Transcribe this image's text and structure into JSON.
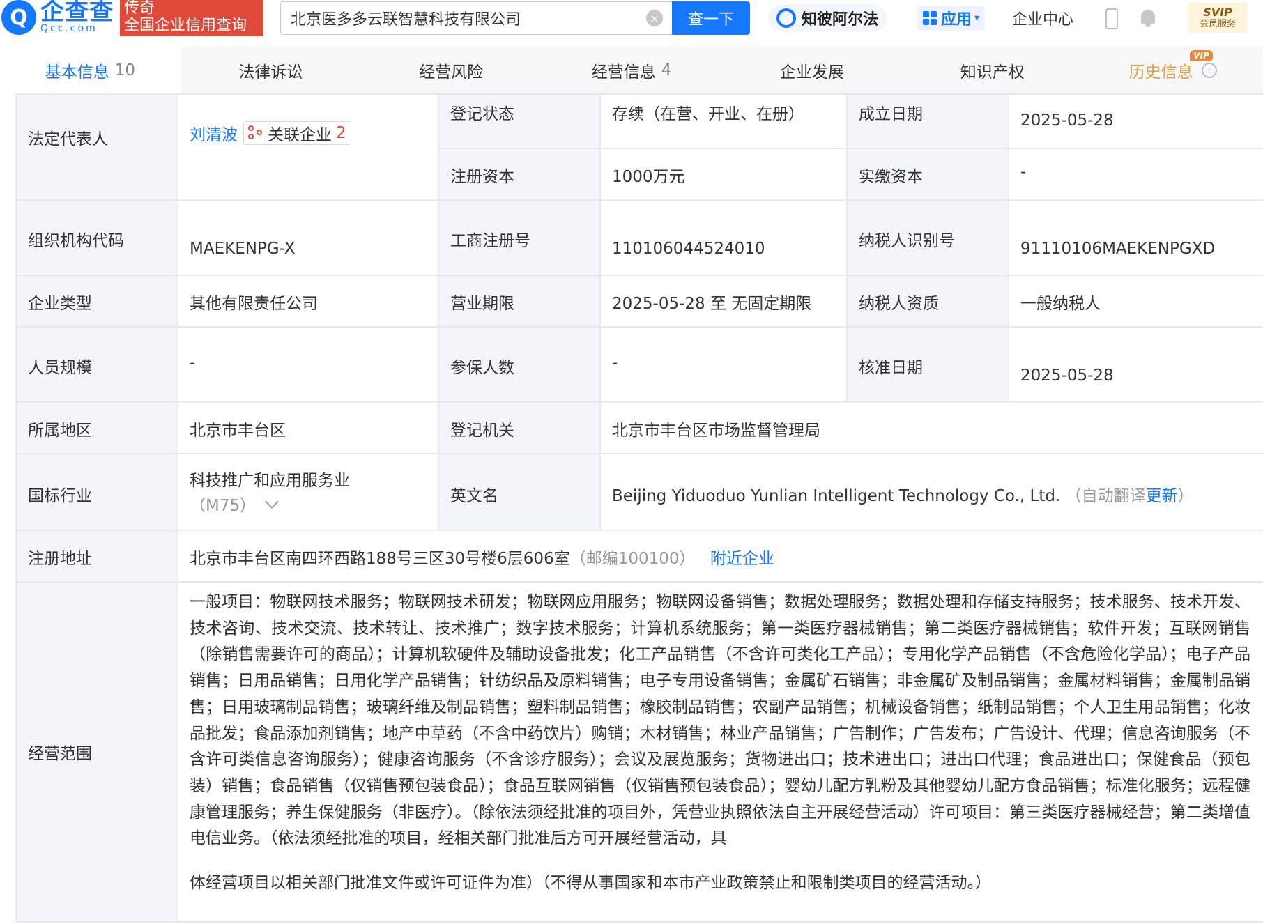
{
  "header": {
    "logo_icon": "Q",
    "logo_main": "企查查",
    "logo_sub": "Qcc.com",
    "slogan_top": "传奇",
    "slogan_bottom": "全国企业信用查询",
    "search_value": "北京医多多云联智慧科技有限公司",
    "clear_symbol": "×",
    "search_button": "查一下",
    "zhibi_label": "知彼阿尔法",
    "apps_label": "应用",
    "apps_caret": "▾",
    "center_label": "企业中心",
    "svip_line1": "SVIP",
    "svip_line2": "会员服务"
  },
  "tabs": [
    {
      "label": "基本信息",
      "count": "10"
    },
    {
      "label": "法律诉讼",
      "count": ""
    },
    {
      "label": "经营风险",
      "count": ""
    },
    {
      "label": "经营信息",
      "count": "4"
    },
    {
      "label": "企业发展",
      "count": ""
    },
    {
      "label": "知识产权",
      "count": ""
    },
    {
      "label": "历史信息",
      "count": "",
      "badge": "VIP"
    }
  ],
  "info_icon_symbol": "i",
  "table": {
    "legal_rep_label": "法定代表人",
    "legal_rep_name": "刘清波",
    "related_label": "关联企业",
    "related_count": "2",
    "reg_status_label": "登记状态",
    "reg_status": "存续（在营、开业、在册）",
    "founded_label": "成立日期",
    "founded": "2025-05-28",
    "reg_capital_label": "注册资本",
    "reg_capital": "1000万元",
    "paid_capital_label": "实缴资本",
    "paid_capital": "-",
    "org_code_label": "组织机构代码",
    "org_code": "MAEKENPG-X",
    "biz_reg_no_label": "工商注册号",
    "biz_reg_no": "110106044524010",
    "tax_id_label": "纳税人识别号",
    "tax_id": "91110106MAEKENPGXD",
    "company_type_label": "企业类型",
    "company_type": "其他有限责任公司",
    "biz_term_label": "营业期限",
    "biz_term": "2025-05-28 至 无固定期限",
    "taxpayer_label": "纳税人资质",
    "taxpayer": "一般纳税人",
    "staff_label": "人员规模",
    "staff": "-",
    "insured_label": "参保人数",
    "insured": "-",
    "approved_label": "核准日期",
    "approved": "2025-05-28",
    "region_label": "所属地区",
    "region": "北京市丰台区",
    "authority_label": "登记机关",
    "authority": "北京市丰台区市场监督管理局",
    "industry_label": "国标行业",
    "industry": "科技推广和应用服务业",
    "industry_code": "（M75）",
    "english_label": "英文名",
    "english_name": "Beijing Yiduoduo Yunlian Intelligent Technology Co., Ltd.",
    "english_note_open": "（自动翻译",
    "english_update": "更新",
    "english_note_close": "）",
    "address_label": "注册地址",
    "address": "北京市丰台区南四环西路188号三区30号楼6层606室",
    "postcode": "（邮编100100）",
    "nearby": "附近企业",
    "scope_label": "经营范围",
    "scope_main": "一般项目：物联网技术服务；物联网技术研发；物联网应用服务；物联网设备销售；数据处理服务；数据处理和存储支持服务；技术服务、技术开发、技术咨询、技术交流、技术转让、技术推广；数字技术服务；计算机系统服务；第一类医疗器械销售；第二类医疗器械销售；软件开发；互联网销售（除销售需要许可的商品）；计算机软硬件及辅助设备批发；化工产品销售（不含许可类化工产品）；专用化学产品销售（不含危险化学品）；电子产品销售；日用品销售；日用化学产品销售；针纺织品及原料销售；电子专用设备销售；金属矿石销售；非金属矿及制品销售；金属材料销售；金属制品销售；日用玻璃制品销售；玻璃纤维及制品销售；塑料制品销售；橡胶制品销售；农副产品销售；机械设备销售；纸制品销售；个人卫生用品销售；化妆品批发；食品添加剂销售；地产中草药（不含中药饮片）购销；木材销售；林业产品销售；广告制作；广告发布；广告设计、代理；信息咨询服务（不含许可类信息咨询服务）；健康咨询服务（不含诊疗服务）；会议及展览服务；货物进出口；技术进出口；进出口代理；食品进出口；保健食品（预包装）销售；食品销售（仅销售预包装食品）；食品互联网销售（仅销售预包装食品）；婴幼儿配方乳粉及其他婴幼儿配方食品销售；标准化服务；远程健康管理服务；养生保健服务（非医疗）。（除依法须经批准的项目外，凭营业执照依法自主开展经营活动）许可项目：第三类医疗器械经营；第二类增值电信业务。（依法须经批准的项目，经相关部门批准后方可开展经营活动，具",
    "scope_tail": "体经营项目以相关部门批准文件或许可证件为准）（不得从事国家和本市产业政策禁止和限制类项目的经营活动。）"
  }
}
